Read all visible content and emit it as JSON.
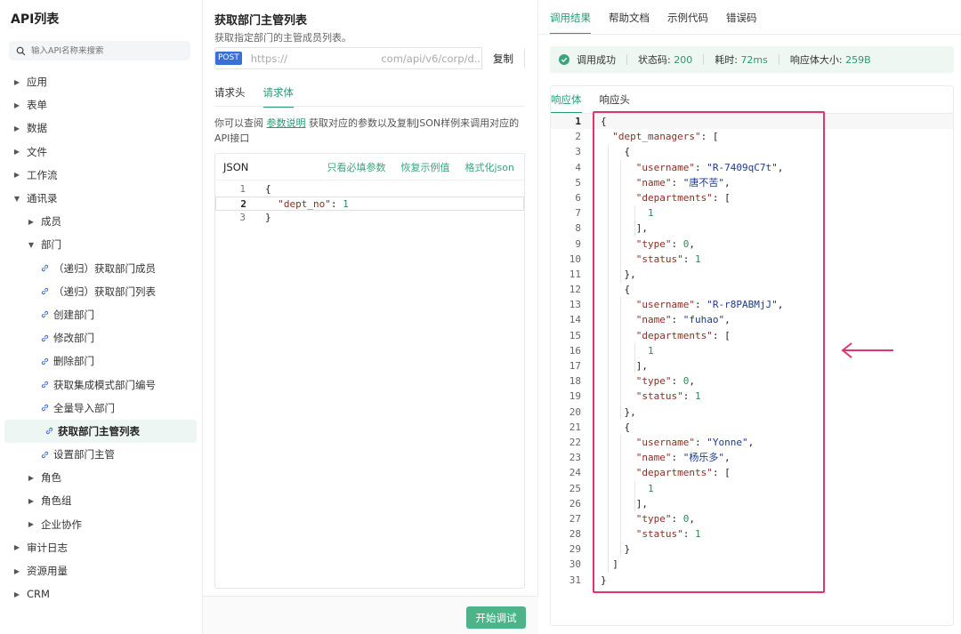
{
  "sidebar": {
    "title": "API列表",
    "search_placeholder": "输入API名称来搜索",
    "items": [
      {
        "label": "应用",
        "level": 0,
        "type": "folder",
        "expanded": false
      },
      {
        "label": "表单",
        "level": 0,
        "type": "folder",
        "expanded": false
      },
      {
        "label": "数据",
        "level": 0,
        "type": "folder",
        "expanded": false
      },
      {
        "label": "文件",
        "level": 0,
        "type": "folder",
        "expanded": false
      },
      {
        "label": "工作流",
        "level": 0,
        "type": "folder",
        "expanded": false
      },
      {
        "label": "通讯录",
        "level": 0,
        "type": "folder",
        "expanded": true
      },
      {
        "label": "成员",
        "level": 1,
        "type": "folder",
        "expanded": false
      },
      {
        "label": "部门",
        "level": 1,
        "type": "folder",
        "expanded": true
      },
      {
        "label": "（递归）获取部门成员",
        "level": 2,
        "type": "api"
      },
      {
        "label": "（递归）获取部门列表",
        "level": 2,
        "type": "api"
      },
      {
        "label": "创建部门",
        "level": 2,
        "type": "api"
      },
      {
        "label": "修改部门",
        "level": 2,
        "type": "api"
      },
      {
        "label": "删除部门",
        "level": 2,
        "type": "api"
      },
      {
        "label": "获取集成模式部门编号",
        "level": 2,
        "type": "api"
      },
      {
        "label": "全量导入部门",
        "level": 2,
        "type": "api"
      },
      {
        "label": "获取部门主管列表",
        "level": 2,
        "type": "api",
        "active": true
      },
      {
        "label": "设置部门主管",
        "level": 2,
        "type": "api"
      },
      {
        "label": "角色",
        "level": 1,
        "type": "folder",
        "expanded": false
      },
      {
        "label": "角色组",
        "level": 1,
        "type": "folder",
        "expanded": false
      },
      {
        "label": "企业协作",
        "level": 1,
        "type": "folder",
        "expanded": false
      },
      {
        "label": "审计日志",
        "level": 0,
        "type": "folder",
        "expanded": false
      },
      {
        "label": "资源用量",
        "level": 0,
        "type": "folder",
        "expanded": false
      },
      {
        "label": "CRM",
        "level": 0,
        "type": "folder",
        "expanded": false
      }
    ]
  },
  "api": {
    "title": "获取部门主管列表",
    "description": "获取指定部门的主管成员列表。",
    "method": "POST",
    "url_start": "https://",
    "url_end": "com/api/v6/corp/d...",
    "copy_label": "复制"
  },
  "request": {
    "tabs": [
      {
        "label": "请求头",
        "active": false
      },
      {
        "label": "请求体",
        "active": true
      }
    ],
    "desc_prefix": "你可以查阅 ",
    "desc_link": "参数说明",
    "desc_suffix": " 获取对应的参数以及复制JSON样例来调用对应的API接口",
    "json_label": "JSON",
    "actions": [
      "只看必填参数",
      "恢复示例值",
      "格式化json"
    ],
    "code_lines": [
      "{",
      "  \"dept_no\": 1",
      "}"
    ],
    "run_label": "开始调试"
  },
  "result": {
    "tabs": [
      {
        "label": "调用结果",
        "active": true
      },
      {
        "label": "帮助文档",
        "active": false
      },
      {
        "label": "示例代码",
        "active": false
      },
      {
        "label": "错误码",
        "active": false
      }
    ],
    "status_text": "调用成功",
    "status_code_label": "状态码:",
    "status_code": "200",
    "time_label": "耗时:",
    "time": "72ms",
    "size_label": "响应体大小:",
    "size": "259B",
    "resp_tabs": [
      {
        "label": "响应体",
        "active": true
      },
      {
        "label": "响应头",
        "active": false
      }
    ],
    "response_lines": [
      "{",
      "  \"dept_managers\": [",
      "    {",
      "      \"username\": \"R-7409qC7t\",",
      "      \"name\": \"唐不苦\",",
      "      \"departments\": [",
      "        1",
      "      ],",
      "      \"type\": 0,",
      "      \"status\": 1",
      "    },",
      "    {",
      "      \"username\": \"R-r8PABMjJ\",",
      "      \"name\": \"fuhao\",",
      "      \"departments\": [",
      "        1",
      "      ],",
      "      \"type\": 0,",
      "      \"status\": 1",
      "    },",
      "    {",
      "      \"username\": \"Yonne\",",
      "      \"name\": \"杨乐多\",",
      "      \"departments\": [",
      "        1",
      "      ],",
      "      \"type\": 0,",
      "      \"status\": 1",
      "    }",
      "  ]",
      "}"
    ]
  },
  "colors": {
    "accent": "#2a9a73",
    "highlight": "#e2346c",
    "method_badge": "#3b6fd8"
  }
}
